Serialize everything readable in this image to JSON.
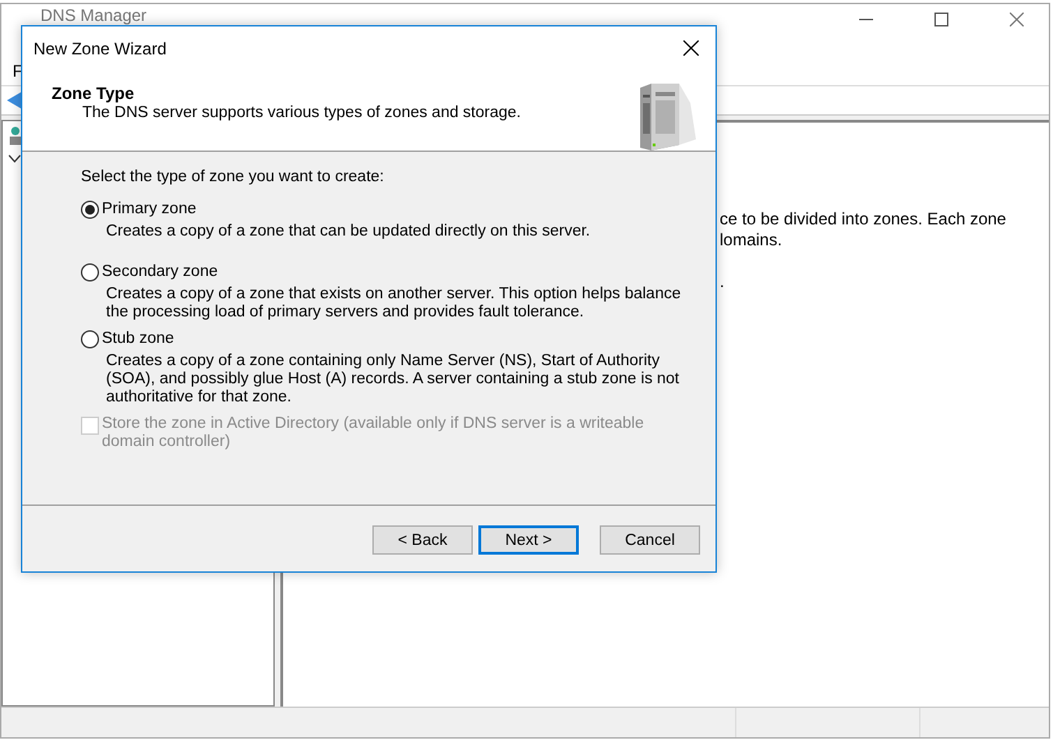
{
  "window": {
    "title": "DNS Manager",
    "menu": [
      "F"
    ]
  },
  "right_pane": {
    "lines": [
      "ce to be divided into zones. Each zone",
      "lomains.",
      "."
    ]
  },
  "dialog": {
    "title": "New Zone Wizard",
    "heading": "Zone Type",
    "subtitle": "The DNS server supports various types of zones and storage.",
    "prompt": "Select the type of zone you want to create:",
    "options": [
      {
        "label": "Primary zone",
        "description": "Creates a copy of a zone that can be updated directly on this server.",
        "selected": true
      },
      {
        "label": "Secondary zone",
        "description": "Creates a copy of a zone that exists on another server. This option helps balance the processing load of primary servers and provides fault tolerance.",
        "selected": false
      },
      {
        "label": "Stub zone",
        "description": "Creates a copy of a zone containing only Name Server (NS), Start of Authority (SOA), and possibly glue Host (A) records. A server containing a stub zone is not authoritative for that zone.",
        "selected": false
      }
    ],
    "store_in_ad": {
      "label": "Store the zone in Active Directory (available only if DNS server is a writeable domain controller)",
      "checked": false,
      "disabled": true
    },
    "buttons": [
      {
        "label": "< Back",
        "default": false
      },
      {
        "label": "Next >",
        "default": true
      },
      {
        "label": "Cancel",
        "default": false
      }
    ]
  }
}
